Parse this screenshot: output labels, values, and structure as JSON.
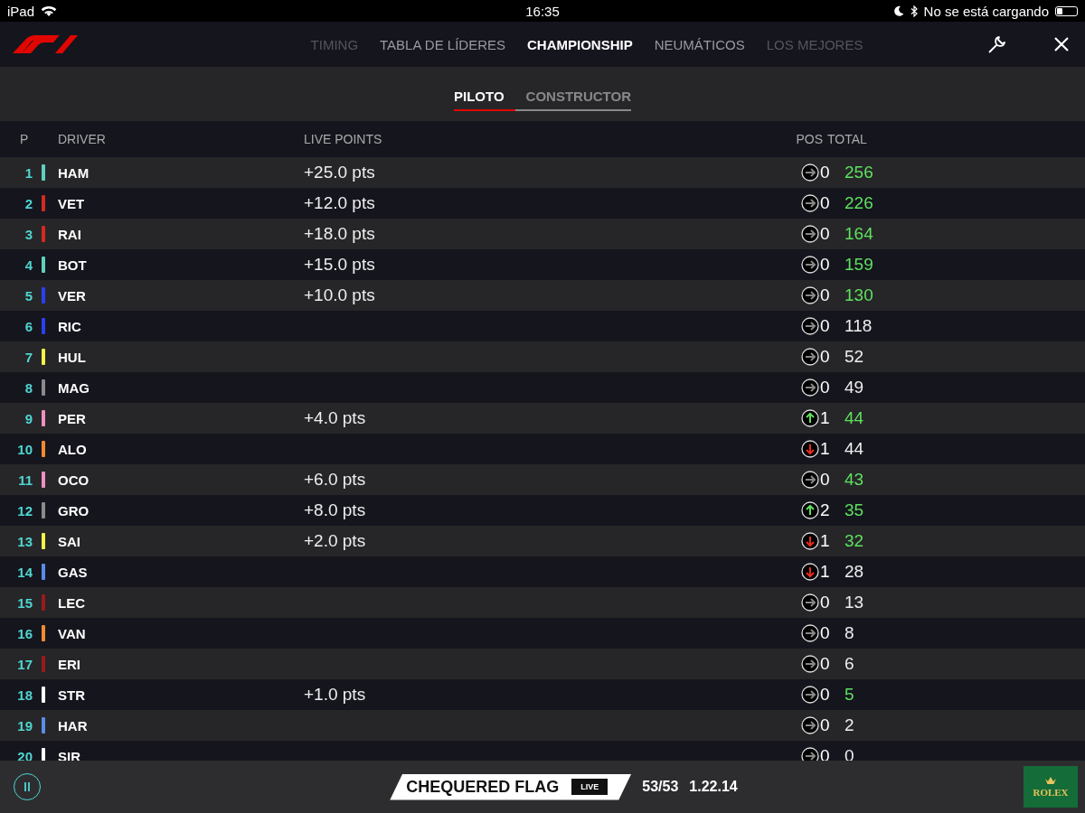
{
  "status_bar": {
    "device": "iPad",
    "time": "16:35",
    "charging": "No se está cargando"
  },
  "nav": {
    "tabs": [
      {
        "label": "TIMING",
        "selected": false
      },
      {
        "label": "TABLA DE LÍDERES",
        "selected": false
      },
      {
        "label": "CHAMPIONSHIP",
        "selected": true
      },
      {
        "label": "NEUMÁTICOS",
        "selected": false
      },
      {
        "label": "LOS MEJORES",
        "selected": false
      }
    ]
  },
  "subtabs": [
    {
      "label": "PILOTO",
      "selected": true
    },
    {
      "label": "CONSTRUCTOR",
      "selected": false
    }
  ],
  "table": {
    "columns": [
      "P",
      "DRIVER",
      "LIVE POINTS",
      "POS",
      "TOTAL"
    ],
    "rows": [
      {
        "p": "1",
        "color": "#5fd0bd",
        "driver": "HAM",
        "live_points": "+25.0 pts",
        "kind": "same",
        "change": "0",
        "total": "256",
        "scored": true
      },
      {
        "p": "2",
        "color": "#d42a20",
        "driver": "VET",
        "live_points": "+12.0 pts",
        "kind": "same",
        "change": "0",
        "total": "226",
        "scored": true
      },
      {
        "p": "3",
        "color": "#d42a20",
        "driver": "RAI",
        "live_points": "+18.0 pts",
        "kind": "same",
        "change": "0",
        "total": "164",
        "scored": true
      },
      {
        "p": "4",
        "color": "#5fd0bd",
        "driver": "BOT",
        "live_points": "+15.0 pts",
        "kind": "same",
        "change": "0",
        "total": "159",
        "scored": true
      },
      {
        "p": "5",
        "color": "#2a3ff0",
        "driver": "VER",
        "live_points": "+10.0 pts",
        "kind": "same",
        "change": "0",
        "total": "130",
        "scored": true
      },
      {
        "p": "6",
        "color": "#2a3ff0",
        "driver": "RIC",
        "kind": "same",
        "change": "0",
        "total": "118",
        "scored": false
      },
      {
        "p": "7",
        "color": "#f5f04a",
        "driver": "HUL",
        "kind": "same",
        "change": "0",
        "total": "52",
        "scored": false
      },
      {
        "p": "8",
        "color": "#8a8a8a",
        "driver": "MAG",
        "kind": "same",
        "change": "0",
        "total": "49",
        "scored": false
      },
      {
        "p": "9",
        "color": "#f08fc0",
        "driver": "PER",
        "live_points": "+4.0 pts",
        "kind": "up",
        "change": "1",
        "total": "44",
        "scored": true
      },
      {
        "p": "10",
        "color": "#f08a30",
        "driver": "ALO",
        "kind": "down",
        "change": "1",
        "total": "44",
        "scored": false
      },
      {
        "p": "11",
        "color": "#f08fc0",
        "driver": "OCO",
        "live_points": "+6.0 pts",
        "kind": "same",
        "change": "0",
        "total": "43",
        "scored": true
      },
      {
        "p": "12",
        "color": "#8a8a8a",
        "driver": "GRO",
        "live_points": "+8.0 pts",
        "kind": "up",
        "change": "2",
        "total": "35",
        "scored": true
      },
      {
        "p": "13",
        "color": "#f5f04a",
        "driver": "SAI",
        "live_points": "+2.0 pts",
        "kind": "down",
        "change": "1",
        "total": "32",
        "scored": true
      },
      {
        "p": "14",
        "color": "#5a8ce8",
        "driver": "GAS",
        "kind": "down",
        "change": "1",
        "total": "28",
        "scored": false
      },
      {
        "p": "15",
        "color": "#9a1a1a",
        "driver": "LEC",
        "kind": "same",
        "change": "0",
        "total": "13",
        "scored": false
      },
      {
        "p": "16",
        "color": "#f08a30",
        "driver": "VAN",
        "kind": "same",
        "change": "0",
        "total": "8",
        "scored": false
      },
      {
        "p": "17",
        "color": "#9a1a1a",
        "driver": "ERI",
        "kind": "same",
        "change": "0",
        "total": "6",
        "scored": false
      },
      {
        "p": "18",
        "color": "#ffffff",
        "driver": "STR",
        "live_points": "+1.0 pts",
        "kind": "same",
        "change": "0",
        "total": "5",
        "scored": true
      },
      {
        "p": "19",
        "color": "#5a8ce8",
        "driver": "HAR",
        "kind": "same",
        "change": "0",
        "total": "2",
        "scored": false
      },
      {
        "p": "20",
        "color": "#ffffff",
        "driver": "SIR",
        "kind": "same",
        "change": "0",
        "total": "0",
        "scored": false
      }
    ]
  },
  "footer": {
    "session": "CHEQUERED FLAG",
    "badge": "LIVE",
    "laps": "53/53",
    "lap_time": "1.22.14",
    "sponsor": "ROLEX"
  }
}
